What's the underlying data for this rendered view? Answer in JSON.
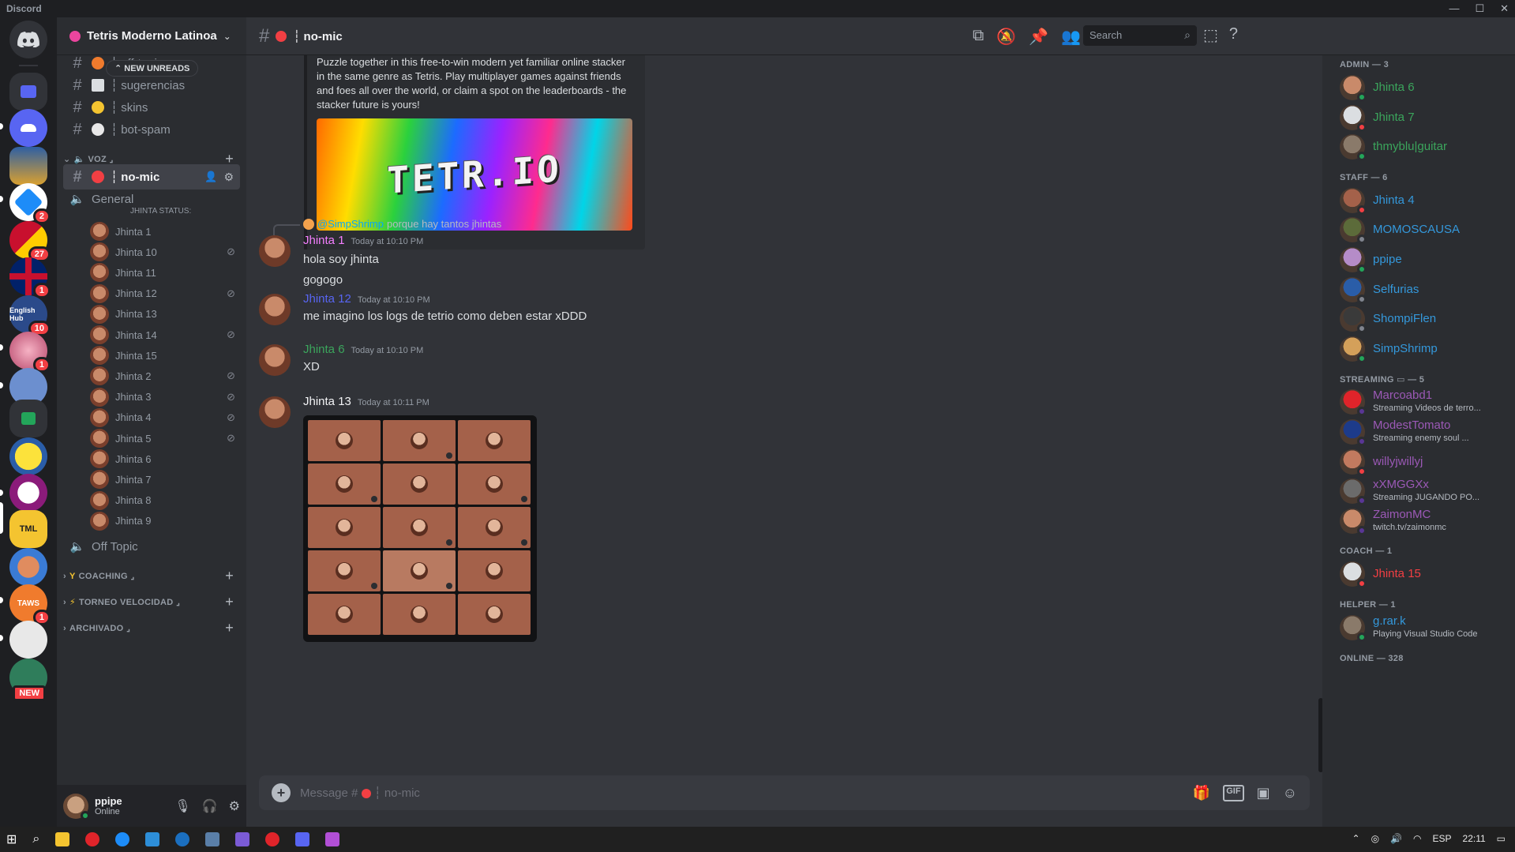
{
  "app": {
    "title": "Discord"
  },
  "rail": {
    "servers": [
      {
        "name": "home",
        "badge": ""
      },
      {
        "name": "folder",
        "badge": ""
      },
      {
        "name": "server-cloud",
        "badge": ""
      },
      {
        "name": "server-juan",
        "badge": ""
      },
      {
        "name": "server-blue",
        "badge": "2"
      },
      {
        "name": "server-flags",
        "badge": "27"
      },
      {
        "name": "server-uk",
        "badge": "1"
      },
      {
        "name": "server-english-hub",
        "badge": "10"
      },
      {
        "name": "server-anime",
        "badge": "1"
      },
      {
        "name": "server-bot",
        "badge": ""
      },
      {
        "name": "server-green",
        "badge": ""
      },
      {
        "name": "server-pikachu",
        "badge": ""
      },
      {
        "name": "server-tetris-colombia",
        "badge": ""
      },
      {
        "name": "server-tml",
        "badge": ""
      },
      {
        "name": "server-avatar",
        "badge": ""
      },
      {
        "name": "server-taws",
        "badge": "1"
      },
      {
        "name": "server-skull",
        "badge": ""
      },
      {
        "name": "server-new",
        "badge": "NEW"
      }
    ],
    "english_hub_label": "English Hub",
    "taws_label": "TAWS",
    "tml_label": "TML"
  },
  "sidebar": {
    "guild_name": "Tetris Moderno Latinoa",
    "new_unreads": "NEW UNREADS",
    "channels_top": [
      {
        "name": "┆ off-topic"
      },
      {
        "name": "┆ sugerencias"
      },
      {
        "name": "┆ skins"
      },
      {
        "name": "┆ bot-spam"
      }
    ],
    "category_voz": "VOZ ⌟",
    "active_channel": "┆ no-mic",
    "voice_general": "General",
    "voice_status": "JHINTA STATUS:",
    "voice_users": [
      "Jhinta 1",
      "Jhinta 10",
      "Jhinta 11",
      "Jhinta 12",
      "Jhinta 13",
      "Jhinta 14",
      "Jhinta 15",
      "Jhinta 2",
      "Jhinta 3",
      "Jhinta 4",
      "Jhinta 5",
      "Jhinta 6",
      "Jhinta 7",
      "Jhinta 8",
      "Jhinta 9"
    ],
    "voice_off_topic": "Off Topic",
    "categories": [
      "COACHING ⌟",
      "TORNEO VELOCIDAD ⌟",
      "ARCHIVADO ⌟"
    ],
    "user": {
      "name": "ppipe",
      "status": "Online"
    }
  },
  "header": {
    "channel": "┆ no-mic",
    "search_placeholder": "Search"
  },
  "embed": {
    "description": "Puzzle together in this free-to-win modern yet familiar online stacker in the same genre as Tetris. Play multiplayer games against friends and foes all over the world, or claim a spot on the leaderboards - the stacker future is yours!",
    "image_logo": "TETR.IO"
  },
  "messages": [
    {
      "reply_mention": "@SimpShrimp",
      "reply_text": "porque hay tantos jhintas",
      "author": "Jhinta 1",
      "author_color": "#f47fff",
      "time": "Today at 10:10 PM",
      "lines": [
        "hola soy jhinta",
        "gogogo"
      ]
    },
    {
      "author": "Jhinta 12",
      "author_color": "#5865f2",
      "time": "Today at 10:10 PM",
      "lines": [
        "me imagino los logs de tetrio como deben estar xDDD"
      ]
    },
    {
      "author": "Jhinta 6",
      "author_color": "#3ba55c",
      "time": "Today at 10:10 PM",
      "lines": [
        "XD"
      ]
    },
    {
      "author": "Jhinta 13",
      "author_color": "#f2f3f5",
      "time": "Today at 10:11 PM",
      "lines": []
    }
  ],
  "composer": {
    "placeholder": "Message #",
    "placeholder_channel": "┆ no-mic"
  },
  "members": {
    "groups": [
      {
        "label": "ADMIN — 3",
        "members": [
          {
            "name": "Jhinta 6",
            "color": "#3ba55c",
            "sub": "",
            "status": "#23a55a"
          },
          {
            "name": "Jhinta 7",
            "color": "#3ba55c",
            "sub": "",
            "status": "#f23f43"
          },
          {
            "name": "thmyblu|guitar",
            "color": "#3ba55c",
            "sub": "",
            "status": "#23a55a"
          }
        ]
      },
      {
        "label": "STAFF — 6",
        "members": [
          {
            "name": "Jhinta 4",
            "color": "#3498db",
            "sub": "",
            "status": "#f23f43"
          },
          {
            "name": "MOMOSCAUSA",
            "color": "#3498db",
            "sub": "",
            "status": "#80848e"
          },
          {
            "name": "ppipe",
            "color": "#3498db",
            "sub": "",
            "status": "#23a55a"
          },
          {
            "name": "Selfurias",
            "color": "#3498db",
            "sub": "",
            "status": "#80848e"
          },
          {
            "name": "ShompiFlen",
            "color": "#3498db",
            "sub": "",
            "status": "#80848e"
          },
          {
            "name": "SimpShrimp",
            "color": "#3498db",
            "sub": "",
            "status": "#23a55a"
          }
        ]
      },
      {
        "label": "STREAMING ▭ — 5",
        "members": [
          {
            "name": "Marcoabd1",
            "color": "#9b59b6",
            "sub": "Streaming Videos de terro...",
            "status": "#593695"
          },
          {
            "name": "ModestTomato",
            "color": "#9b59b6",
            "sub": "Streaming enemy soul ...",
            "status": "#593695"
          },
          {
            "name": "willyjwillyj",
            "color": "#9b59b6",
            "sub": "",
            "status": "#f23f43"
          },
          {
            "name": "xXMGGXx",
            "color": "#9b59b6",
            "sub": "Streaming JUGANDO PO...",
            "status": "#593695"
          },
          {
            "name": "ZaimonMC",
            "color": "#9b59b6",
            "sub": "twitch.tv/zaimonmc",
            "status": "#593695"
          }
        ]
      },
      {
        "label": "COACH — 1",
        "members": [
          {
            "name": "Jhinta 15",
            "color": "#f23f43",
            "sub": "",
            "status": "#f23f43"
          }
        ]
      },
      {
        "label": "HELPER — 1",
        "members": [
          {
            "name": "g.rar.k",
            "color": "#3498db",
            "sub": "Playing Visual Studio Code",
            "status": "#23a55a"
          }
        ]
      },
      {
        "label": "ONLINE — 328",
        "members": []
      }
    ]
  },
  "taskbar": {
    "lang": "ESP",
    "time": "22:11"
  }
}
